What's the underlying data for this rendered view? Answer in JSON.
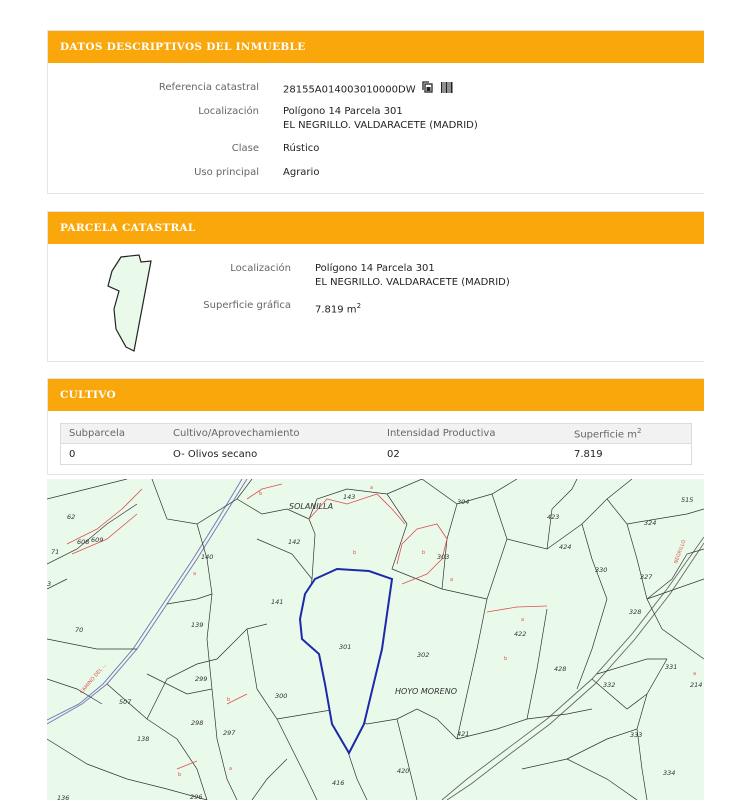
{
  "datos": {
    "title": "DATOS DESCRIPTIVOS DEL INMUEBLE",
    "ref_label": "Referencia catastral",
    "ref_value": "28155A014003010000DW",
    "loc_label": "Localización",
    "loc_line1": "Polígono 14 Parcela 301",
    "loc_line2": "EL NEGRILLO. VALDARACETE (MADRID)",
    "clase_label": "Clase",
    "clase_value": "Rústico",
    "uso_label": "Uso principal",
    "uso_value": "Agrario",
    "icons": [
      "copy-icon",
      "barcode-icon"
    ]
  },
  "parcela": {
    "title": "PARCELA CATASTRAL",
    "loc_label": "Localización",
    "loc_line1": "Polígono 14 Parcela 301",
    "loc_line2": "EL NEGRILLO. VALDARACETE (MADRID)",
    "sup_label": "Superficie gráfica",
    "sup_value": "7.819 m",
    "sup_exp": "2"
  },
  "cultivo": {
    "title": "CULTIVO",
    "headers": [
      "Subparcela",
      "Cultivo/Aprovechamiento",
      "Intensidad Productiva",
      "Superficie m"
    ],
    "header_exp": "2",
    "rows": [
      [
        "0",
        "O- Olivos secano",
        "02",
        "7.819"
      ]
    ]
  },
  "map": {
    "place_labels": [
      "SOLANILLA",
      "HOYO MORENO"
    ],
    "road_labels": [
      "CAMINO DEL ...",
      "NEGRILLO"
    ],
    "parcel_numbers": [
      "62",
      "71",
      "70",
      "140",
      "139",
      "142",
      "143",
      "141",
      "301",
      "302",
      "303",
      "304",
      "423",
      "424",
      "422",
      "428",
      "421",
      "420",
      "416",
      "300",
      "299",
      "298",
      "297",
      "296",
      "507",
      "138",
      "136",
      "324",
      "327",
      "328",
      "330",
      "331",
      "332",
      "333",
      "334",
      "214",
      "515",
      "608",
      "609",
      "3"
    ],
    "letters": [
      "a",
      "b"
    ],
    "colors": {
      "background": "#eafaea",
      "lines": "#333333",
      "highlight": "#1a2aa8",
      "subparcel": "#e05050",
      "header": "#f9a70b"
    }
  }
}
